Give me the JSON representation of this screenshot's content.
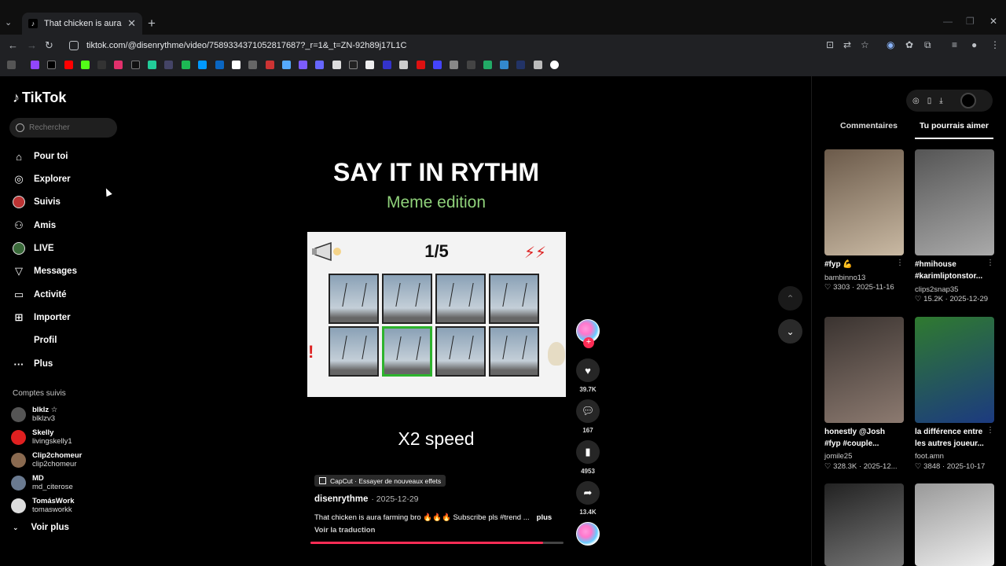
{
  "browser": {
    "tab_title": "That chicken is aura farming",
    "url": "tiktok.com/@disenrythme/video/7589334371052817687?_r=1&_t=ZN-92h89j17L1C"
  },
  "sidebar": {
    "logo": "TikTok",
    "search_placeholder": "Rechercher",
    "nav": [
      {
        "label": "Pour toi",
        "icon": "home-icon"
      },
      {
        "label": "Explorer",
        "icon": "compass-icon"
      },
      {
        "label": "Suivis",
        "icon": "avatar-icon"
      },
      {
        "label": "Amis",
        "icon": "friends-icon"
      },
      {
        "label": "LIVE",
        "icon": "live-icon"
      },
      {
        "label": "Messages",
        "icon": "messages-icon"
      },
      {
        "label": "Activité",
        "icon": "activity-icon"
      },
      {
        "label": "Importer",
        "icon": "upload-icon"
      },
      {
        "label": "Profil",
        "icon": ""
      },
      {
        "label": "Plus",
        "icon": "more-icon"
      }
    ],
    "followed_title": "Comptes suivis",
    "followed": [
      {
        "name": "blklz ☆",
        "user": "blklzv3",
        "color": "#555"
      },
      {
        "name": "Skelly",
        "user": "livingskelly1",
        "color": "#e02020"
      },
      {
        "name": "Clip2chomeur",
        "user": "clip2chomeur",
        "color": "#8a6a50"
      },
      {
        "name": "MD",
        "user": "md_citerose",
        "color": "#6a7a90"
      },
      {
        "name": "TomásWork",
        "user": "tomasworkk",
        "color": "#ddd"
      }
    ],
    "see_more": "Voir plus"
  },
  "video": {
    "title": "SAY IT IN RYTHM",
    "subtitle": "Meme edition",
    "fraction": "1/5",
    "speed_text": "X2 speed",
    "capcut": "CapCut · Essayer de nouveaux effets",
    "author": "disenrythme",
    "date": "· 2025-12-29",
    "description": "That chicken is aura farming bro 🔥🔥🔥 Subscribe pls #trend ...",
    "more": "plus",
    "translate": "Voir la traduction",
    "progress": 0.92
  },
  "actions": {
    "likes": "39.7K",
    "comments": "167",
    "saves": "4953",
    "shares": "13.4K"
  },
  "right_panel": {
    "tab_comments": "Commentaires",
    "tab_suggest": "Tu pourrais aimer",
    "cards": [
      {
        "title": "#fyp 💪",
        "user": "bambinno13",
        "likes": "3303",
        "date": "2025-11-16",
        "colors": [
          "#6b5a4a",
          "#c9b9a3"
        ]
      },
      {
        "title": "#hmihouse #karimliptonstor...",
        "user": "clips2snap35",
        "likes": "15.2K",
        "date": "2025-12-29",
        "colors": [
          "#555",
          "#aaa"
        ]
      },
      {
        "title": "honestly @Josh #fyp #couple...",
        "user": "jomile25",
        "likes": "328.3K",
        "date": "2025-12...",
        "colors": [
          "#3a3330",
          "#8c7a70"
        ]
      },
      {
        "title": "la différence entre les autres joueur...",
        "user": "foot.amn",
        "likes": "3848",
        "date": "2025-10-17",
        "colors": [
          "#2f7a2f",
          "#1c3a80"
        ]
      },
      {
        "title": "",
        "user": "",
        "likes": "",
        "date": "",
        "colors": [
          "#222",
          "#777"
        ]
      },
      {
        "title": "",
        "user": "",
        "likes": "",
        "date": "",
        "colors": [
          "#999",
          "#eee"
        ]
      }
    ]
  },
  "colors": {
    "accent": "#fe2c55",
    "green": "#8fd17a"
  }
}
